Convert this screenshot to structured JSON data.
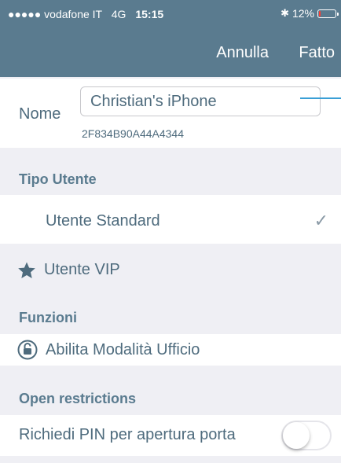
{
  "status_bar": {
    "signal": "●●●●● vodafone IT",
    "network": "4G",
    "time": "15:15",
    "bluetooth": "✱",
    "battery": "12%",
    "battery_level": 0.12,
    "battery_color": "#ff3b30"
  },
  "nav": {
    "cancel_label": "Annulla",
    "done_label": "Fatto",
    "bar_color": "#5a7b8f"
  },
  "device": {
    "name_label": "Nome",
    "name_value": "Christian's iPhone",
    "device_id": "2F834B90A44A4344"
  },
  "user_type": {
    "header": "Tipo Utente",
    "options": [
      {
        "label": "Utente Standard",
        "selected": true
      },
      {
        "label": "Utente VIP",
        "icon": "star-icon",
        "selected": false
      }
    ]
  },
  "functions": {
    "header": "Funzioni",
    "items": [
      {
        "label": "Abilita Modalità Ufficio",
        "icon": "unlock-icon"
      }
    ]
  },
  "open_restrictions": {
    "header": "Open restrictions",
    "pin_label": "Richiedi PIN per apertura porta",
    "pin_enabled": false
  },
  "colors": {
    "text": "#4e6b7d",
    "accent_line": "#3a9fd6",
    "background": "#efeff4"
  }
}
